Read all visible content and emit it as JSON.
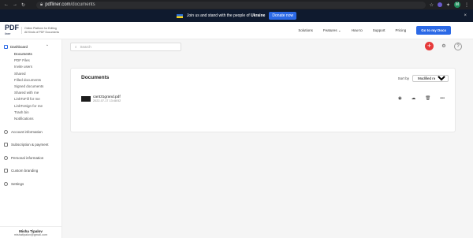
{
  "browser": {
    "url_host": "pdfliner.com",
    "url_path": "/documents"
  },
  "banner": {
    "text_prefix": "Join us and stand with the people of",
    "text_bold": "Ukraine",
    "donate_label": "Donate now",
    "close": "×"
  },
  "header": {
    "logo_text": "PDF",
    "logo_sub": "liner",
    "tagline_1": "Online Platform for Editing",
    "tagline_2": "All Kinds of PDF Documents",
    "menu": [
      "Solutions",
      "Features ⌄",
      "How to",
      "Support",
      "Pricing"
    ],
    "cta": "Go to my Docs"
  },
  "sidebar": {
    "dashboard_label": "Dashboard",
    "dashboard_items": [
      "Documents",
      "PDF Files",
      "Invite users",
      "Shared",
      "Filled documents",
      "Signed documents",
      "Shared with me",
      "LinkToFill for me",
      "LinkToSign for me",
      "Trash bin",
      "Notifications"
    ],
    "sections": [
      "Account information",
      "Subscription & payment",
      "Personal information",
      "Custom branding",
      "Settings"
    ],
    "user_name": "Misha Tipalov",
    "user_email": "mishatipalov@gmail.com"
  },
  "main": {
    "search_placeholder": "Search",
    "documents_title": "Documents",
    "sort_label": "Sort by",
    "sort_value": "Modified newest",
    "files": [
      {
        "name": "cant31grand.pdf",
        "date": "2022-07-17 13:48:52"
      }
    ]
  },
  "colors": {
    "accent": "#2b69e6",
    "add_button": "#e63a3a",
    "banner_bg": "#0f1a2e"
  }
}
